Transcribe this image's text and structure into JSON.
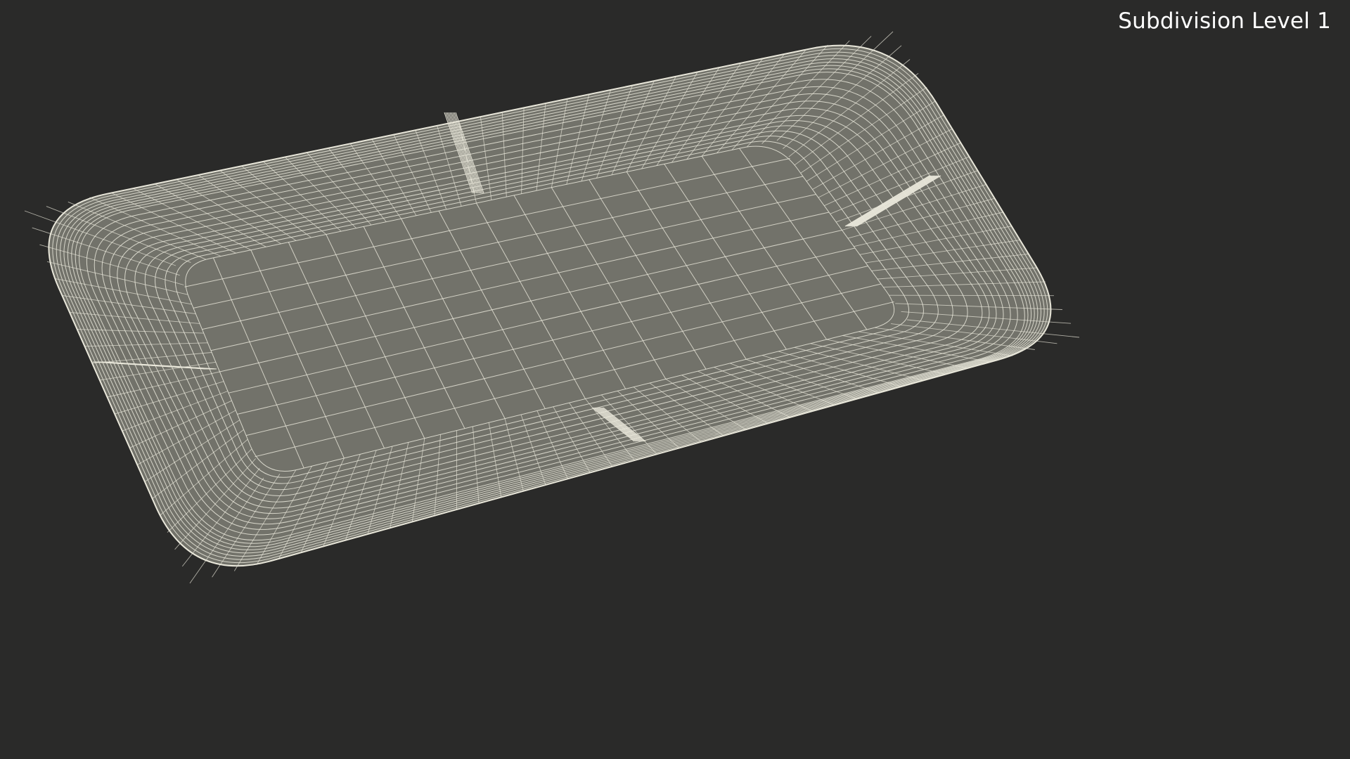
{
  "overlay": {
    "subdivision_label": "Subdivision Level 1"
  },
  "colors": {
    "background": "#2a2a29",
    "tray_fill": "#72726a",
    "wire": "#e9e7da",
    "label": "#ffffff"
  },
  "scene": {
    "object": "rectangular tray wireframe",
    "ribs": 4
  }
}
